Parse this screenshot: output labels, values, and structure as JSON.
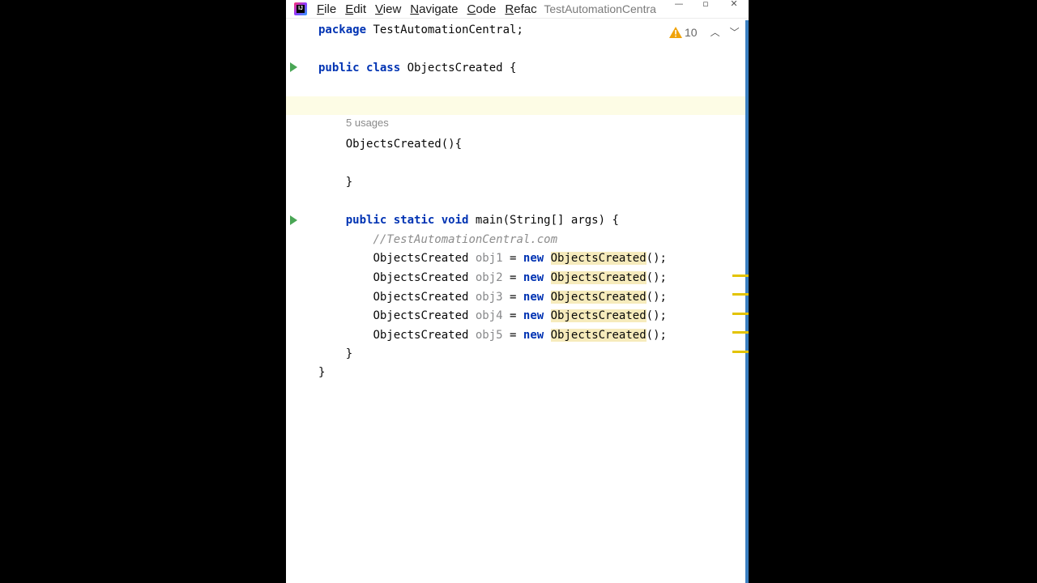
{
  "titlebar": {
    "menu": [
      {
        "mnemonic": "F",
        "rest": "ile"
      },
      {
        "mnemonic": "E",
        "rest": "dit"
      },
      {
        "mnemonic": "V",
        "rest": "iew"
      },
      {
        "mnemonic": "N",
        "rest": "avigate"
      },
      {
        "mnemonic": "C",
        "rest": "ode"
      },
      {
        "mnemonic": "R",
        "rest": "efact"
      }
    ],
    "window_title": "TestAutomationCentra",
    "minimize": "—",
    "maximize": "▫",
    "close": "✕"
  },
  "inspection": {
    "warning_count": "10",
    "up": "︿",
    "down": "﹀"
  },
  "code": {
    "package_kw": "package",
    "package_rest": " TestAutomationCentral;",
    "class_kw1": "public",
    "class_kw2": "class",
    "class_rest": " ObjectsCreated {",
    "usages_hint": "5 usages",
    "constructor": "    ObjectsCreated(){",
    "constructor_close": "    }",
    "main_indent": "    ",
    "main_kw1": "public",
    "main_kw2": "static",
    "main_kw3": "void",
    "main_rest": " main(String[] args) {",
    "comment_indent": "        ",
    "comment": "//TestAutomationCentral.com",
    "decl_indent": "        ",
    "decl_type": "ObjectsCreated ",
    "decl_eq": " = ",
    "decl_new": "new",
    "decl_class": "ObjectsCreated",
    "decl_end": "();",
    "objects": [
      "obj1",
      "obj2",
      "obj3",
      "obj4",
      "obj5"
    ],
    "main_close": "    }",
    "class_close": "}"
  },
  "colors": {
    "keyword": "#0033b3",
    "run_gutter": "#49a655",
    "warning": "#e3c300",
    "highlight": "#f6ebbc"
  }
}
